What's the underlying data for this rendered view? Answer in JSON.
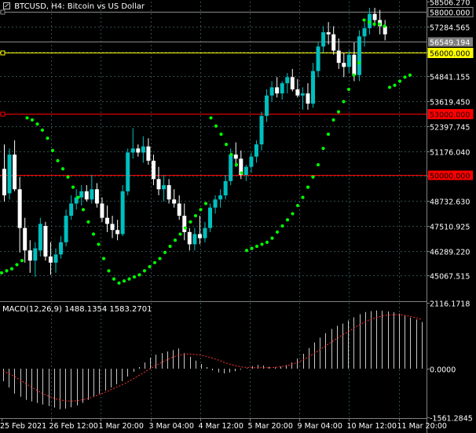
{
  "title": {
    "symbol": "BTCUSD",
    "timeframe": "H4",
    "description": "Bitcoin vs US Dollar"
  },
  "macd_label": "MACD(12,26,9) 1488.1354 1583.2701",
  "colors": {
    "background": "#000000",
    "grid": "#2f4f4f",
    "bull": "#00bfbf",
    "bear": "#ffffff",
    "sar": "#00ff00",
    "macd_hist": "#c8c8c8",
    "macd_signal": "#ff3030",
    "hline_gray": "#8a8a8a",
    "hline_yellow": "#ffff00",
    "hline_red": "#ff0000"
  },
  "chart_data": [
    {
      "type": "candlestick",
      "title": "BTCUSD, H4: Bitcoin vs US Dollar",
      "ylim": [
        43846.0,
        58506.27
      ],
      "y_ticks": [
        "58506.270",
        "57284.565",
        "56062.860",
        "54841.155",
        "53619.450",
        "52397.745",
        "51176.040",
        "49954.335",
        "48732.630",
        "47510.925",
        "46289.220",
        "45067.515"
      ],
      "x_ticks": [
        "25 Feb 2021",
        "26 Feb 12:00",
        "1 Mar 20:00",
        "3 Mar 04:00",
        "4 Mar 12:00",
        "5 Mar 20:00",
        "9 Mar 04:00",
        "10 Mar 12:00",
        "11 Mar 20:00"
      ],
      "levels": [
        {
          "price": 58000.0,
          "label": "58000.000",
          "kind": "gray",
          "tag": "boxed"
        },
        {
          "price": 56549.194,
          "label": "56549.194",
          "kind": "gray",
          "tag": "bid"
        },
        {
          "price": 56000.0,
          "label": "56000.000",
          "kind": "yellow",
          "tag": "boxed"
        },
        {
          "price": 53000.0,
          "label": "53000.000",
          "kind": "red",
          "tag": "boxed"
        },
        {
          "price": 50000.0,
          "label": "50000.000",
          "kind": "red",
          "tag": "plain"
        }
      ],
      "candles": [
        {
          "o": 50300,
          "h": 51500,
          "l": 48700,
          "c": 49000
        },
        {
          "o": 49100,
          "h": 51300,
          "l": 48800,
          "c": 51000
        },
        {
          "o": 51000,
          "h": 51700,
          "l": 49200,
          "c": 49300
        },
        {
          "o": 49300,
          "h": 49900,
          "l": 46200,
          "c": 47400
        },
        {
          "o": 47400,
          "h": 47900,
          "l": 45700,
          "c": 46300
        },
        {
          "o": 46300,
          "h": 46800,
          "l": 45200,
          "c": 45800
        },
        {
          "o": 45800,
          "h": 46700,
          "l": 45000,
          "c": 46400
        },
        {
          "o": 46300,
          "h": 47900,
          "l": 46000,
          "c": 47600
        },
        {
          "o": 47500,
          "h": 47700,
          "l": 45800,
          "c": 46000
        },
        {
          "o": 46000,
          "h": 46700,
          "l": 45100,
          "c": 45700
        },
        {
          "o": 45700,
          "h": 46400,
          "l": 45200,
          "c": 46100
        },
        {
          "o": 46100,
          "h": 47000,
          "l": 45900,
          "c": 46700
        },
        {
          "o": 46700,
          "h": 48300,
          "l": 46500,
          "c": 48000
        },
        {
          "o": 48000,
          "h": 49000,
          "l": 47800,
          "c": 48600
        },
        {
          "o": 48600,
          "h": 49300,
          "l": 48300,
          "c": 48900
        },
        {
          "o": 48900,
          "h": 49500,
          "l": 48500,
          "c": 49200
        },
        {
          "o": 49200,
          "h": 49500,
          "l": 48700,
          "c": 48800
        },
        {
          "o": 48800,
          "h": 50000,
          "l": 48600,
          "c": 49300
        },
        {
          "o": 49300,
          "h": 49600,
          "l": 48400,
          "c": 48600
        },
        {
          "o": 48600,
          "h": 48900,
          "l": 47700,
          "c": 47900
        },
        {
          "o": 47900,
          "h": 48500,
          "l": 47200,
          "c": 47600
        },
        {
          "o": 47600,
          "h": 48000,
          "l": 46900,
          "c": 47300
        },
        {
          "o": 47300,
          "h": 47800,
          "l": 46800,
          "c": 47100
        },
        {
          "o": 47100,
          "h": 49500,
          "l": 47000,
          "c": 49200
        },
        {
          "o": 49200,
          "h": 51300,
          "l": 49000,
          "c": 51100
        },
        {
          "o": 51100,
          "h": 52300,
          "l": 50800,
          "c": 51300
        },
        {
          "o": 51300,
          "h": 51500,
          "l": 50900,
          "c": 51100
        },
        {
          "o": 51100,
          "h": 51900,
          "l": 50600,
          "c": 51400
        },
        {
          "o": 51400,
          "h": 51800,
          "l": 50500,
          "c": 50700
        },
        {
          "o": 50700,
          "h": 51000,
          "l": 49500,
          "c": 49800
        },
        {
          "o": 49800,
          "h": 50400,
          "l": 49000,
          "c": 49300
        },
        {
          "o": 49300,
          "h": 50000,
          "l": 48700,
          "c": 49500
        },
        {
          "o": 49500,
          "h": 49800,
          "l": 48600,
          "c": 48800
        },
        {
          "o": 48800,
          "h": 49300,
          "l": 48400,
          "c": 48600
        },
        {
          "o": 48600,
          "h": 49000,
          "l": 47800,
          "c": 48000
        },
        {
          "o": 48000,
          "h": 48600,
          "l": 46800,
          "c": 47200
        },
        {
          "o": 47200,
          "h": 47400,
          "l": 46300,
          "c": 46600
        },
        {
          "o": 46600,
          "h": 47400,
          "l": 46300,
          "c": 47100
        },
        {
          "o": 47100,
          "h": 48000,
          "l": 46600,
          "c": 46900
        },
        {
          "o": 46900,
          "h": 47700,
          "l": 46700,
          "c": 47400
        },
        {
          "o": 47400,
          "h": 48600,
          "l": 47200,
          "c": 48400
        },
        {
          "o": 48400,
          "h": 49000,
          "l": 48100,
          "c": 48800
        },
        {
          "o": 48800,
          "h": 49300,
          "l": 48400,
          "c": 49000
        },
        {
          "o": 49000,
          "h": 50000,
          "l": 48800,
          "c": 49700
        },
        {
          "o": 49700,
          "h": 51300,
          "l": 49500,
          "c": 51000
        },
        {
          "o": 51000,
          "h": 51600,
          "l": 50400,
          "c": 50800
        },
        {
          "o": 50800,
          "h": 51200,
          "l": 49800,
          "c": 50000
        },
        {
          "o": 50000,
          "h": 50500,
          "l": 49700,
          "c": 50400
        },
        {
          "o": 50400,
          "h": 51100,
          "l": 50100,
          "c": 50900
        },
        {
          "o": 50900,
          "h": 51700,
          "l": 50600,
          "c": 51500
        },
        {
          "o": 51500,
          "h": 53100,
          "l": 51200,
          "c": 52900
        },
        {
          "o": 52900,
          "h": 54200,
          "l": 52600,
          "c": 53900
        },
        {
          "o": 53900,
          "h": 54600,
          "l": 53600,
          "c": 54300
        },
        {
          "o": 54300,
          "h": 54800,
          "l": 53800,
          "c": 54000
        },
        {
          "o": 54000,
          "h": 54600,
          "l": 53700,
          "c": 54500
        },
        {
          "o": 54500,
          "h": 55000,
          "l": 54000,
          "c": 54800
        },
        {
          "o": 54800,
          "h": 55200,
          "l": 54100,
          "c": 54200
        },
        {
          "o": 54200,
          "h": 54700,
          "l": 53800,
          "c": 53900
        },
        {
          "o": 53900,
          "h": 54300,
          "l": 53200,
          "c": 54000
        },
        {
          "o": 54000,
          "h": 54500,
          "l": 53200,
          "c": 53500
        },
        {
          "o": 53500,
          "h": 55500,
          "l": 53300,
          "c": 55100
        },
        {
          "o": 55100,
          "h": 56500,
          "l": 54800,
          "c": 56300
        },
        {
          "o": 56300,
          "h": 57300,
          "l": 56000,
          "c": 57000
        },
        {
          "o": 57000,
          "h": 57500,
          "l": 56400,
          "c": 56900
        },
        {
          "o": 56900,
          "h": 57300,
          "l": 55900,
          "c": 56100
        },
        {
          "o": 56100,
          "h": 56700,
          "l": 55200,
          "c": 55500
        },
        {
          "o": 55500,
          "h": 56000,
          "l": 54800,
          "c": 55300
        },
        {
          "o": 55300,
          "h": 56100,
          "l": 55000,
          "c": 55900
        },
        {
          "o": 55900,
          "h": 56500,
          "l": 54600,
          "c": 54900
        },
        {
          "o": 54900,
          "h": 57100,
          "l": 54600,
          "c": 56800
        },
        {
          "o": 56800,
          "h": 57500,
          "l": 56300,
          "c": 57200
        },
        {
          "o": 57200,
          "h": 58200,
          "l": 56900,
          "c": 57900
        },
        {
          "o": 57900,
          "h": 58200,
          "l": 57300,
          "c": 57600
        },
        {
          "o": 57600,
          "h": 58100,
          "l": 56900,
          "c": 57300
        },
        {
          "o": 57300,
          "h": 57600,
          "l": 56600,
          "c": 56900
        }
      ],
      "sar": [
        45200,
        45300,
        45400,
        45600,
        45800,
        52800,
        52700,
        52500,
        52200,
        51800,
        51200,
        50700,
        50300,
        49900,
        49400,
        48900,
        48300,
        47700,
        47100,
        46600,
        45900,
        45300,
        44900,
        44700,
        44800,
        44900,
        45000,
        45100,
        45300,
        45500,
        45700,
        45900,
        46200,
        46500,
        46800,
        47100,
        47400,
        47700,
        48000,
        48300,
        48600,
        52800,
        52400,
        52000,
        51500,
        51000,
        50500,
        50100,
        46300,
        46400,
        46500,
        46600,
        46700,
        46900,
        47200,
        47500,
        47800,
        48100,
        48500,
        48900,
        49400,
        49900,
        50500,
        51300,
        52000,
        52700,
        53100,
        53600,
        54200,
        54900,
        55500,
        57600,
        57500,
        57400,
        57400,
        57300,
        54300,
        54400,
        54600,
        54800,
        54900
      ],
      "macd": {
        "label": "MACD(12,26,9)",
        "macd_value": 1488.1354,
        "signal_value": 1583.2701,
        "ylim": [
          -1561.2845,
          2116.1718
        ],
        "y_ticks": [
          "2116.1718",
          "0.0000",
          "-1561.2845"
        ],
        "hist": [
          -400,
          -600,
          -800,
          -900,
          -1000,
          -1050,
          -1100,
          -1150,
          -1200,
          -1250,
          -1300,
          -1280,
          -1240,
          -1180,
          -1100,
          -1000,
          -900,
          -800,
          -700,
          -600,
          -500,
          -400,
          -250,
          -100,
          50,
          200,
          350,
          450,
          500,
          550,
          600,
          650,
          500,
          380,
          260,
          150,
          50,
          -50,
          -120,
          -150,
          -120,
          -80,
          -30,
          20,
          80,
          120,
          100,
          60,
          40,
          70,
          120,
          200,
          320,
          480,
          660,
          840,
          1000,
          1140,
          1280,
          1380,
          1450,
          1550,
          1650,
          1750,
          1820,
          1850,
          1870,
          1860,
          1840,
          1810,
          1770,
          1700,
          1640,
          1580,
          1500
        ],
        "signal": [
          -80,
          -150,
          -250,
          -360,
          -480,
          -590,
          -700,
          -800,
          -880,
          -950,
          -1000,
          -1030,
          -1040,
          -1030,
          -1000,
          -960,
          -900,
          -830,
          -760,
          -680,
          -600,
          -520,
          -430,
          -330,
          -220,
          -110,
          0,
          100,
          200,
          290,
          370,
          430,
          460,
          470,
          460,
          430,
          390,
          340,
          280,
          210,
          150,
          100,
          60,
          40,
          30,
          30,
          30,
          30,
          40,
          60,
          90,
          140,
          200,
          280,
          380,
          490,
          610,
          730,
          850,
          970,
          1080,
          1190,
          1300,
          1410,
          1500,
          1580,
          1640,
          1690,
          1720,
          1730,
          1730,
          1710,
          1680,
          1640,
          1583
        ]
      }
    }
  ]
}
